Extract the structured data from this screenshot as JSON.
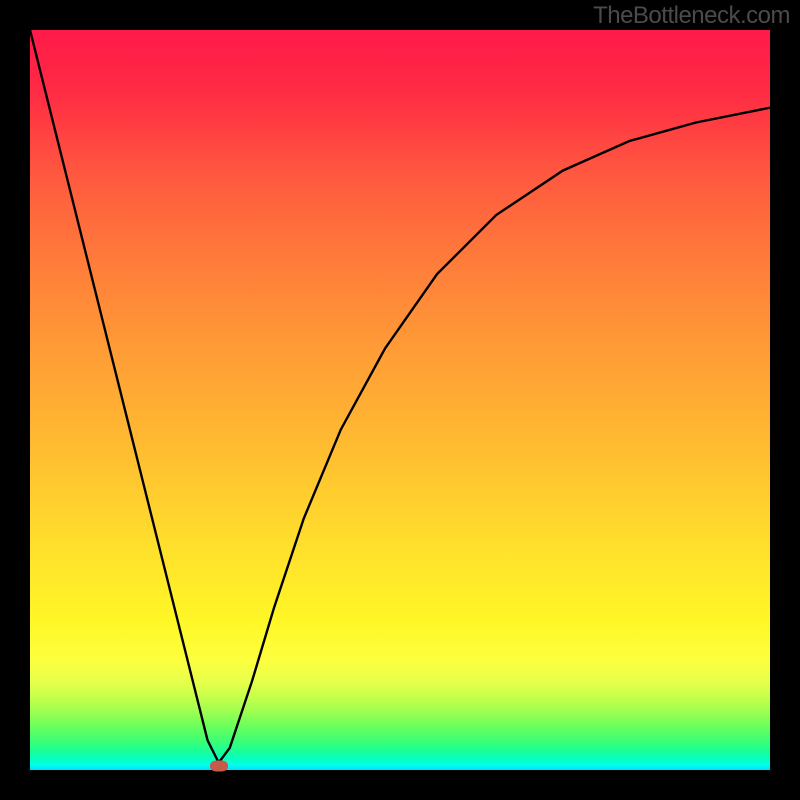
{
  "watermark": "TheBottleneck.com",
  "chart_data": {
    "type": "line",
    "title": "",
    "xlabel": "",
    "ylabel": "",
    "xlim": [
      0,
      1
    ],
    "ylim": [
      0,
      1
    ],
    "background_gradient": {
      "top_color": "#ff1a49",
      "mid_color": "#ffe02c",
      "bottom_color": "#01e0ff"
    },
    "series": [
      {
        "name": "bottleneck-curve",
        "x": [
          0.0,
          0.05,
          0.1,
          0.15,
          0.2,
          0.24,
          0.255,
          0.27,
          0.3,
          0.33,
          0.37,
          0.42,
          0.48,
          0.55,
          0.63,
          0.72,
          0.81,
          0.9,
          1.0
        ],
        "y": [
          1.0,
          0.8,
          0.6,
          0.4,
          0.2,
          0.04,
          0.01,
          0.03,
          0.12,
          0.22,
          0.34,
          0.46,
          0.57,
          0.67,
          0.75,
          0.81,
          0.85,
          0.875,
          0.895
        ]
      }
    ],
    "marker": {
      "x": 0.255,
      "y": 0.006,
      "color": "#c65b4a"
    }
  }
}
